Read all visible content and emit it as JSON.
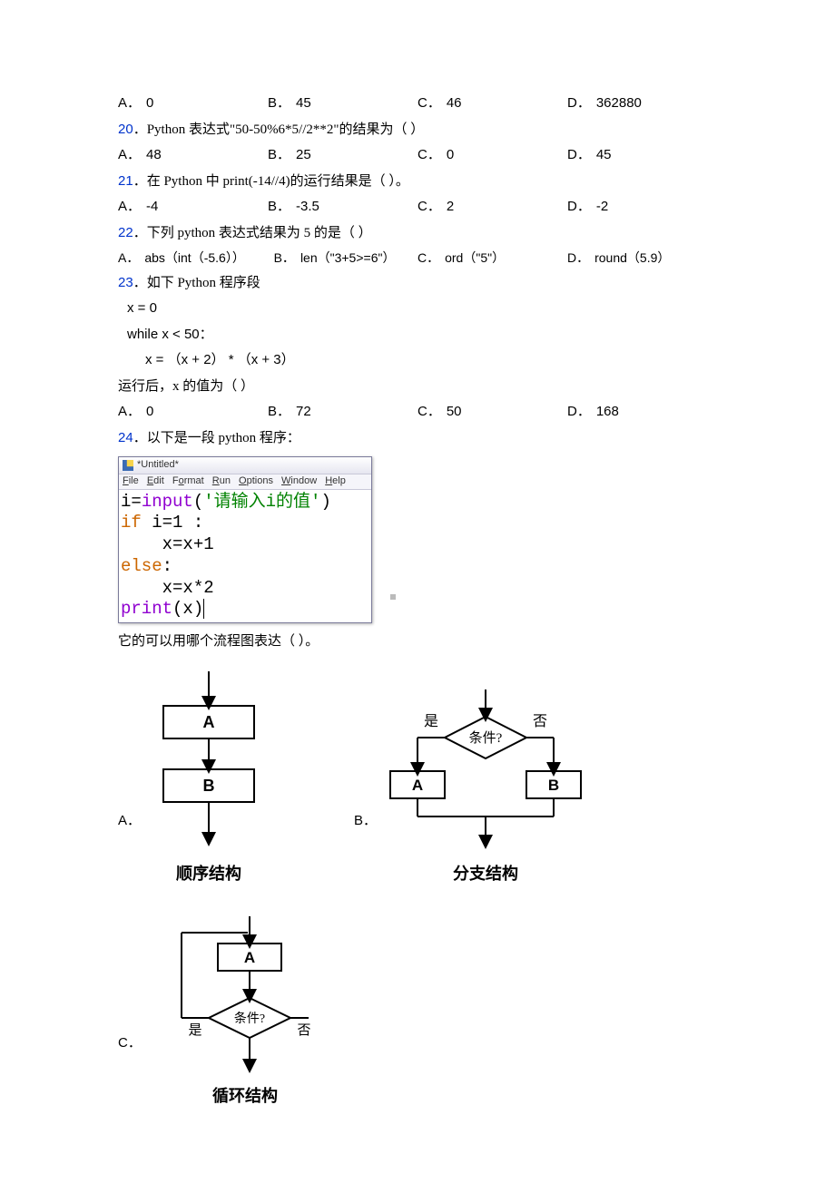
{
  "q19": {
    "opts": [
      {
        "l": "A．",
        "t": "0"
      },
      {
        "l": "B．",
        "t": "45"
      },
      {
        "l": "C．",
        "t": "46"
      },
      {
        "l": "D．",
        "t": "362880"
      }
    ]
  },
  "q20": {
    "num": "20",
    "text": "．Python 表达式\"50-50%6*5//2**2\"的结果为（ ）",
    "opts": [
      {
        "l": "A．",
        "t": "48"
      },
      {
        "l": "B．",
        "t": "25"
      },
      {
        "l": "C．",
        "t": "0"
      },
      {
        "l": "D．",
        "t": "45"
      }
    ]
  },
  "q21": {
    "num": "21",
    "text": "．在 Python 中 print(-14//4)的运行结果是（  ）。",
    "opts": [
      {
        "l": "A．",
        "t": "-4"
      },
      {
        "l": "B．",
        "t": "-3.5"
      },
      {
        "l": "C．",
        "t": "2"
      },
      {
        "l": "D．",
        "t": "-2"
      }
    ]
  },
  "q22": {
    "num": "22",
    "text": "．下列 python 表达式结果为 5 的是（    ）",
    "opts": [
      {
        "l": "A．",
        "t": "abs（int（-5.6））"
      },
      {
        "l": "B．",
        "t": "len（\"3+5>=6\"）"
      },
      {
        "l": "C．",
        "t": "ord（\"5\"）"
      },
      {
        "l": "D．",
        "t": "round（5.9）"
      }
    ]
  },
  "q23": {
    "num": "23",
    "text": "．如下 Python 程序段",
    "code": {
      "l1": "x = 0",
      "l2": "while x < 50：",
      "l3": "x = （x + 2） * （x + 3）"
    },
    "after": "运行后，x 的值为（ ）",
    "opts": [
      {
        "l": "A．",
        "t": "0"
      },
      {
        "l": "B．",
        "t": "72"
      },
      {
        "l": "C．",
        "t": "50"
      },
      {
        "l": "D．",
        "t": "168"
      }
    ]
  },
  "q24": {
    "num": "24",
    "text": "．以下是一段 python 程序：",
    "ide_title": "*Untitled*",
    "ide_menu": [
      "File",
      "Edit",
      "Format",
      "Run",
      "Options",
      "Window",
      "Help"
    ],
    "code": {
      "l1_a": "i=",
      "l1_b": "input",
      "l1_c": "(",
      "l1_d": "'请输入i的值'",
      "l1_e": ")",
      "l2_a": "if",
      "l2_b": " i=1 :",
      "l3": "    x=x+1",
      "l4": "else",
      "l4_b": ":",
      "l5": "    x=x*2",
      "l6_a": "print",
      "l6_b": "(x)"
    },
    "after": "它的可以用哪个流程图表达（  ）。",
    "figs": {
      "A": {
        "letter": "A．",
        "caption": "顺序结构",
        "boxA": "A",
        "boxB": "B"
      },
      "B": {
        "letter": "B．",
        "caption": "分支结构",
        "cond": "条件?",
        "yes": "是",
        "no": "否",
        "boxA": "A",
        "boxB": "B"
      },
      "C": {
        "letter": "C．",
        "caption": "循环结构",
        "cond": "条件?",
        "yes": "是",
        "no": "否",
        "boxA": "A"
      }
    }
  }
}
